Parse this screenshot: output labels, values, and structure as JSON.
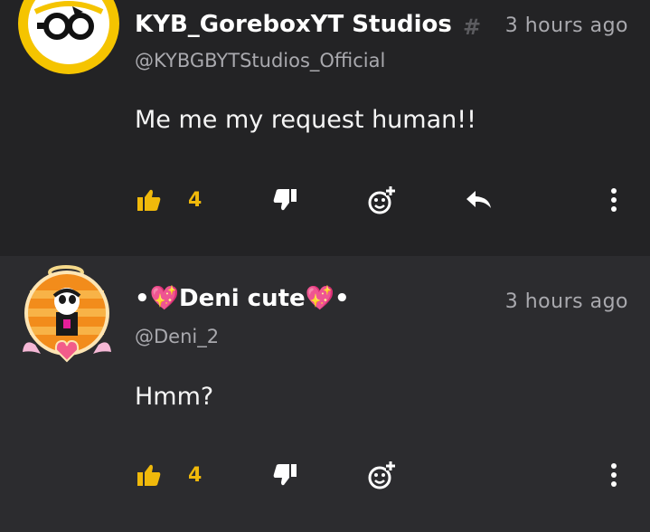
{
  "comments": [
    {
      "author": "KYB_GoreboxYT Studios",
      "author_suffix": "#",
      "time": "3 hours ago",
      "handle": "@KYBGBYTStudios_Official",
      "text": "Me me my request human!!",
      "likes": "4",
      "has_reply_button": true
    },
    {
      "author": "•💖Deni cute💖•",
      "time": "3 hours ago",
      "handle": "@Deni_2",
      "text": "Hmm?",
      "likes": "4",
      "has_reply_button": false
    }
  ],
  "colors": {
    "accent": "#f0b90b",
    "background": "#232325",
    "background_alt": "#2c2c2f",
    "muted": "#a9a9ae"
  },
  "icons": [
    "thumbs-up-icon",
    "thumbs-down-icon",
    "add-emoji-icon",
    "reply-icon",
    "more-options-icon"
  ]
}
